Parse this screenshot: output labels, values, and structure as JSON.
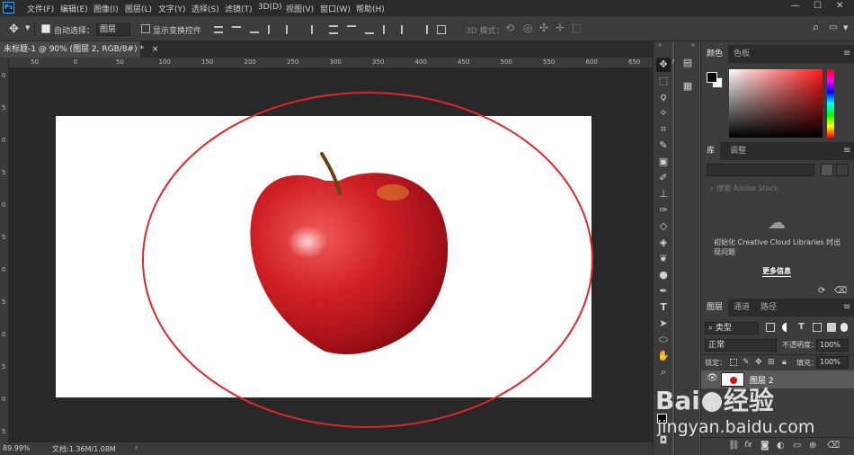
{
  "app": {
    "logo_text": "Ps"
  },
  "menubar": {
    "items": [
      "文件(F)",
      "编辑(E)",
      "图像(I)",
      "图层(L)",
      "文字(Y)",
      "选择(S)",
      "滤镜(T)",
      "3D(D)",
      "视图(V)",
      "窗口(W)",
      "帮助(H)"
    ],
    "window_controls": [
      "—",
      "☐",
      "✕"
    ]
  },
  "options": {
    "auto_select_label": "自动选择：",
    "auto_select_checked": true,
    "auto_select_target": "图层",
    "show_transform_label": "显示变换控件",
    "show_transform_checked": false,
    "mode_3d_label": "3D 模式："
  },
  "document": {
    "tab_title": "未标题-1 @ 90% (图层 2, RGB/8#) *",
    "tab_close": "×",
    "zoom": "89.99%",
    "doc_info": "文档:1.36M/1.08M",
    "ruler_h": [
      "50",
      "0",
      "50",
      "100",
      "150",
      "200",
      "250",
      "300",
      "350",
      "400",
      "450",
      "500",
      "550",
      "600",
      "650",
      "700"
    ],
    "ruler_v": [
      "0",
      "5",
      "0",
      "5",
      "0",
      "5",
      "0",
      "5",
      "0",
      "5",
      "0",
      "5"
    ]
  },
  "ellipse_color": "#e0262a",
  "panels": {
    "color": {
      "tabs": [
        "颜色",
        "色板"
      ]
    },
    "library": {
      "tabs": [
        "库",
        "调整"
      ],
      "search_placeholder": "搜索 Adobe Stock",
      "message": "初始化 Creative Cloud Libraries 时出现问题",
      "more_info": "更多信息"
    },
    "layers": {
      "tabs": [
        "图层",
        "通道",
        "路径"
      ],
      "filter_kind": "类型",
      "blend_mode": "正常",
      "opacity_label": "不透明度：",
      "opacity_value": "100%",
      "lock_label": "锁定：",
      "fill_label": "填充：",
      "fill_value": "100%",
      "layer_name": "图层 2"
    }
  },
  "watermark": {
    "brand": "Bai",
    "brand2": "经验",
    "url": "jingyan.baidu.com"
  }
}
